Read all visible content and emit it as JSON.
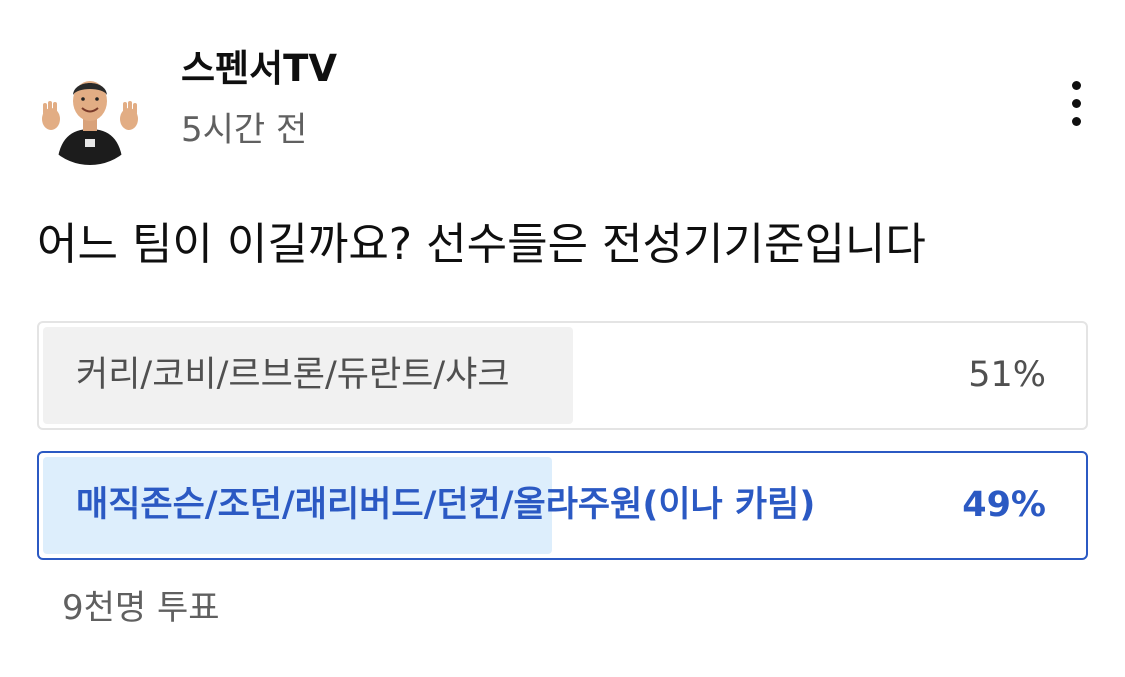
{
  "post": {
    "channel_name": "스펜서TV",
    "time_ago": "5시간 전",
    "question": "어느 팀이 이길까요? 선수들은 전성기기준입니다",
    "menu_icon": "more-vert-icon",
    "avatar_icon": "avatar"
  },
  "poll": {
    "options": [
      {
        "label": "커리/코비/르브론/듀란트/샤크",
        "percent_text": "51%",
        "percent": 51,
        "selected": false
      },
      {
        "label": "매직존슨/조던/래리버드/던컨/올라주원(이나 카림)",
        "percent_text": "49%",
        "percent": 49,
        "selected": true
      }
    ],
    "vote_count": "9천명 투표"
  },
  "colors": {
    "accent": "#2b59c3",
    "selected_fill": "#ddeefc",
    "unselected_fill": "#f1f1f1",
    "unselected_border": "#e4e4e4",
    "secondary_text": "#606060"
  }
}
